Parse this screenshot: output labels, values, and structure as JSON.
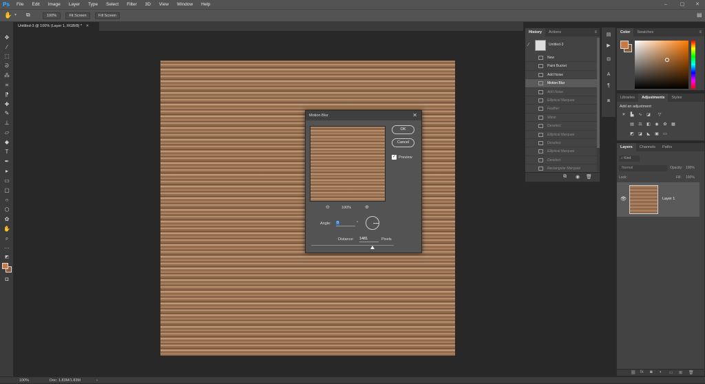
{
  "app": {
    "logo": "Ps"
  },
  "menu": [
    "File",
    "Edit",
    "Image",
    "Layer",
    "Type",
    "Select",
    "Filter",
    "3D",
    "View",
    "Window",
    "Help"
  ],
  "options": {
    "zoom_btn": "100%",
    "fit_btn": "Fit Screen",
    "fill_btn": "Fill Screen"
  },
  "document": {
    "tab_title": "Untitled-3 @ 100% (Layer 1, RGB/8) *"
  },
  "status": {
    "zoom": "100%",
    "doc": "Doc: 1.83M/1.83M"
  },
  "history": {
    "tabs": [
      "History",
      "Actions"
    ],
    "snapshot": "Untitled-3",
    "items": [
      {
        "label": "New",
        "state": "done"
      },
      {
        "label": "Paint Bucket",
        "state": "done"
      },
      {
        "label": "Add Noise",
        "state": "done"
      },
      {
        "label": "Motion Blur",
        "state": "selected"
      },
      {
        "label": "Add Noise",
        "state": "undone"
      },
      {
        "label": "Elliptical Marquee",
        "state": "undone"
      },
      {
        "label": "Feather",
        "state": "undone"
      },
      {
        "label": "Wave",
        "state": "undone"
      },
      {
        "label": "Deselect",
        "state": "undone"
      },
      {
        "label": "Elliptical Marquee",
        "state": "undone"
      },
      {
        "label": "Deselect",
        "state": "undone"
      },
      {
        "label": "Elliptical Marquee",
        "state": "undone"
      },
      {
        "label": "Deselect",
        "state": "undone"
      },
      {
        "label": "Rectangular Marquee",
        "state": "undone"
      }
    ]
  },
  "color_panel": {
    "tabs": [
      "Color",
      "Swatches"
    ],
    "fg_color": "#c87a45",
    "bg_color": "#8a5a3a"
  },
  "adjustments": {
    "tabs": [
      "Libraries",
      "Adjustments",
      "Styles"
    ],
    "heading": "Add an adjustment"
  },
  "layers": {
    "tabs": [
      "Layers",
      "Channels",
      "Paths"
    ],
    "filter": "Kind",
    "blend_mode": "Normal",
    "opacity_label": "Opacity:",
    "opacity": "100%",
    "lock_label": "Lock:",
    "fill_label": "Fill:",
    "fill": "100%",
    "layer_name": "Layer 1"
  },
  "motion_blur": {
    "title": "Motion Blur",
    "ok": "OK",
    "cancel": "Cancel",
    "preview_label": "Preview",
    "preview_checked": true,
    "preview_zoom": "100%",
    "angle_label": "Angle:",
    "angle": "0",
    "degree": "°",
    "distance_label": "Distance:",
    "distance": "1481",
    "distance_unit": "Pixels",
    "distance_fraction": 0.74
  },
  "colors": {
    "accent": "#31a8ff",
    "wood_base": "#9a7253"
  }
}
